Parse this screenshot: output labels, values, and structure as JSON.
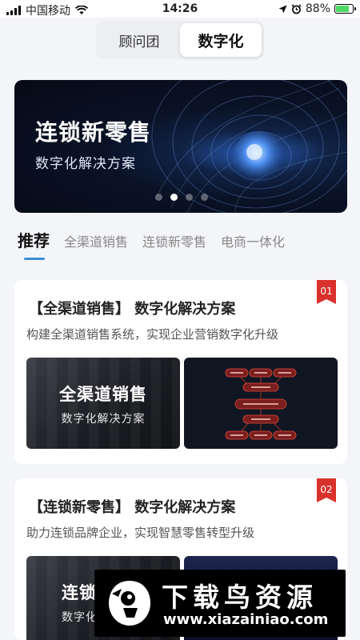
{
  "status_bar": {
    "carrier": "中国移动",
    "time": "14:26",
    "battery": "88%",
    "battery_level": 0.88
  },
  "segment": {
    "items": [
      {
        "label": "顾问团",
        "active": false
      },
      {
        "label": "数字化",
        "active": true
      }
    ]
  },
  "banner": {
    "title": "连锁新零售",
    "subtitle": "数字化解决方案",
    "slide_count": 4,
    "active_slide": 2
  },
  "tabs": [
    {
      "label": "推荐",
      "active": true
    },
    {
      "label": "全渠道销售",
      "active": false
    },
    {
      "label": "连锁新零售",
      "active": false
    },
    {
      "label": "电商一体化",
      "active": false
    }
  ],
  "cards": [
    {
      "badge": "01",
      "heading": "【全渠道销售】 数字化解决方案",
      "desc": "构建全渠道销售系统，实现企业营销数字化升级",
      "thumb_title": "全渠道销售",
      "thumb_subtitle": "数字化解决方案"
    },
    {
      "badge": "02",
      "heading": "【连锁新零售】 数字化解决方案",
      "desc": "助力连锁品牌企业，实现智慧零售转型升级",
      "thumb_title": "连锁",
      "thumb_subtitle": "数字化"
    }
  ],
  "watermark": {
    "title": "下载鸟资源",
    "url": "www.xiazainiao.com"
  },
  "colors": {
    "accent": "#3d8fd9",
    "badge": "#d9312b",
    "battery": "#4cd964"
  }
}
